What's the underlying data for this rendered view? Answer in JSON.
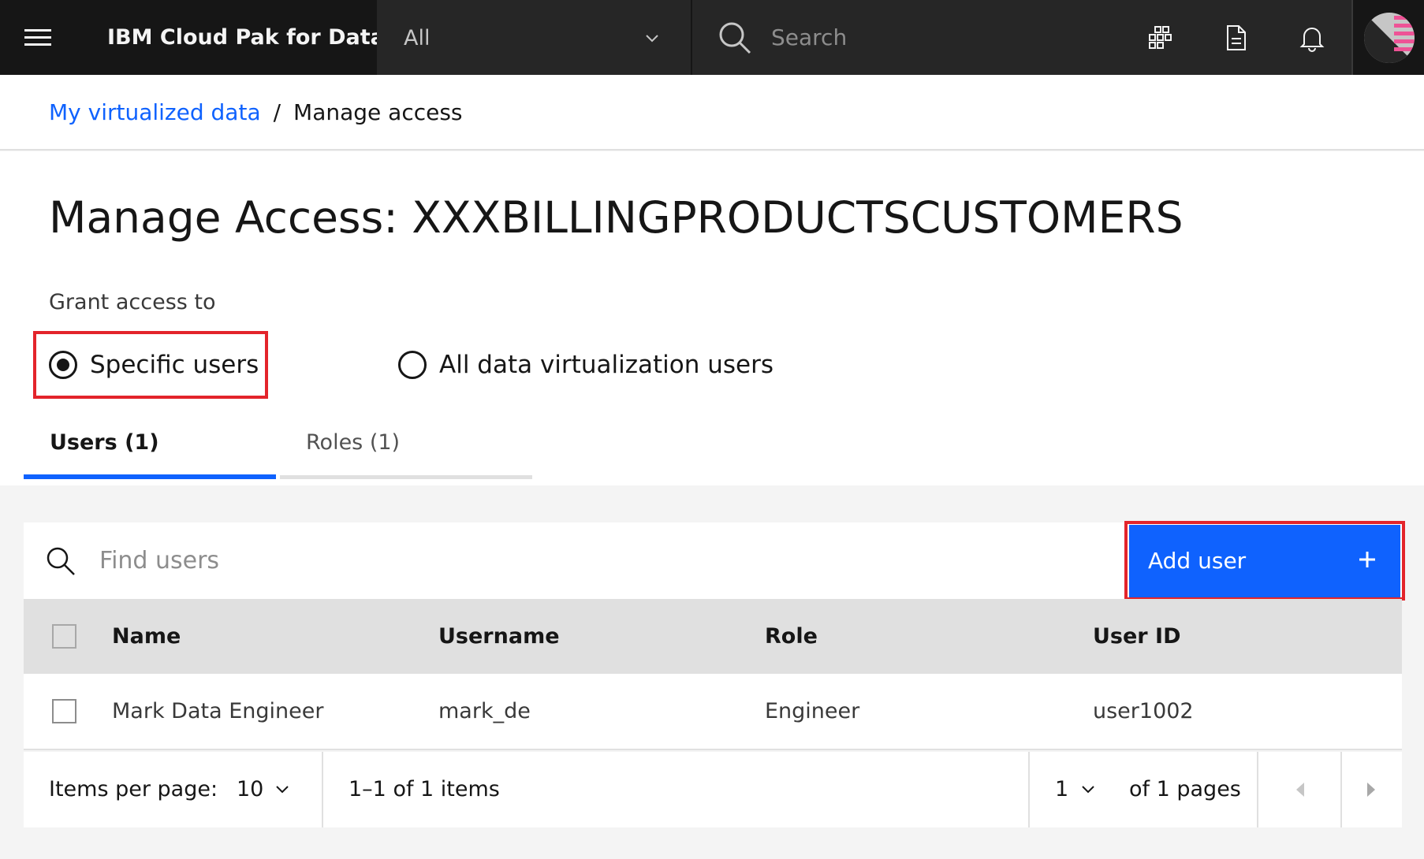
{
  "header": {
    "product_name": "IBM Cloud Pak for Data",
    "context_select_value": "All",
    "search_placeholder": "Search"
  },
  "breadcrumb": {
    "link": "My virtualized data",
    "separator": "/",
    "current": "Manage access"
  },
  "page": {
    "title": "Manage Access: XXXBILLINGPRODUCTSCUSTOMERS",
    "grant_label": "Grant access to",
    "options": [
      {
        "label": "Specific users",
        "selected": true
      },
      {
        "label": "All data virtualization users",
        "selected": false
      }
    ],
    "tabs": [
      {
        "label": "Users (1)",
        "active": true
      },
      {
        "label": "Roles (1)",
        "active": false
      }
    ]
  },
  "table": {
    "find_placeholder": "Find users",
    "add_button_label": "Add user",
    "columns": [
      "Name",
      "Username",
      "Role",
      "User ID"
    ],
    "rows": [
      {
        "name": "Mark Data Engineer",
        "username": "mark_de",
        "role": "Engineer",
        "user_id": "user1002"
      }
    ]
  },
  "pagination": {
    "items_per_page_label": "Items per page:",
    "items_per_page_value": "10",
    "range_text": "1–1 of 1 items",
    "page_value": "1",
    "page_total_text": "of 1 pages"
  },
  "colors": {
    "accent": "#0f62fe",
    "highlight": "#e3242b"
  }
}
